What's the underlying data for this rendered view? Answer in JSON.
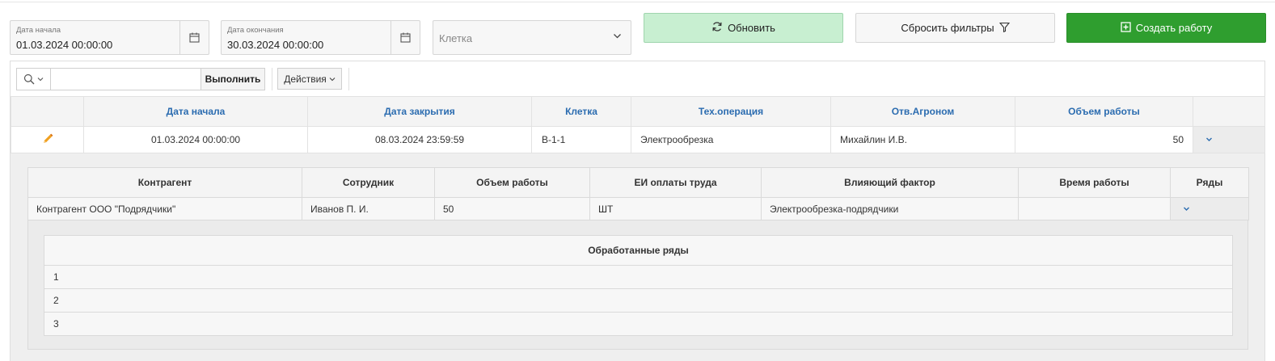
{
  "filters": {
    "start": {
      "label": "Дата начала",
      "value": "01.03.2024 00:00:00"
    },
    "end": {
      "label": "Дата окончания",
      "value": "30.03.2024 00:00:00"
    },
    "cell": {
      "placeholder": "Клетка"
    }
  },
  "buttons": {
    "refresh": "Обновить",
    "reset": "Сбросить фильтры",
    "create": "Создать работу"
  },
  "toolbar": {
    "run": "Выполнить",
    "actions": "Действия"
  },
  "main_table": {
    "headers": [
      "Дата начала",
      "Дата закрытия",
      "Клетка",
      "Тех.операция",
      "Отв.Агроном",
      "Объем работы"
    ],
    "row": {
      "start": "01.03.2024 00:00:00",
      "close": "08.03.2024 23:59:59",
      "cell": "В-1-1",
      "operation": "Электрообрезка",
      "agronomist": "Михайлин И.В.",
      "volume": "50"
    }
  },
  "sub_table": {
    "headers": [
      "Контрагент",
      "Сотрудник",
      "Объем работы",
      "ЕИ оплаты труда",
      "Влияющий фактор",
      "Время работы",
      "Ряды"
    ],
    "row": {
      "contractor": "Контрагент ООО \"Подрядчики\"",
      "employee": "Иванов П. И.",
      "volume": "50",
      "unit": "ШТ",
      "factor": "Электрообрезка-подрядчики",
      "time": ""
    }
  },
  "rows_table": {
    "header": "Обработанные ряды",
    "rows": [
      "1",
      "2",
      "3"
    ]
  },
  "colors": {
    "accent_blue": "#2b6cb0",
    "create_green": "#2f9e2f",
    "refresh_green": "#c8efd1",
    "edit_orange": "#f0a020"
  }
}
